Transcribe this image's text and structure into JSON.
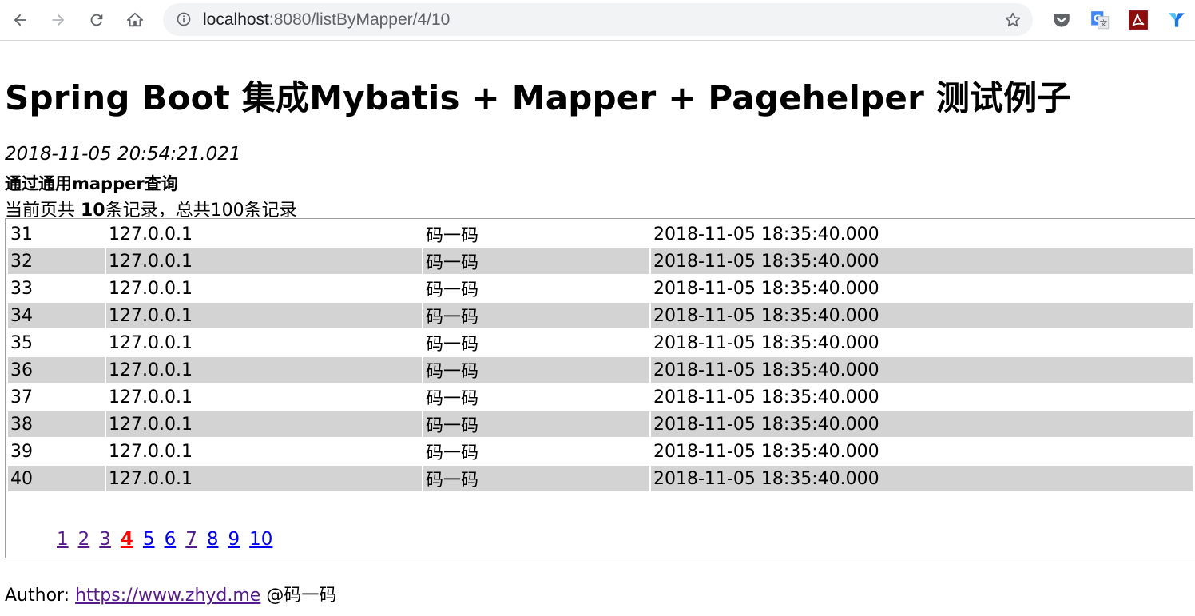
{
  "browser": {
    "url_host": "localhost",
    "url_path": ":8080/listByMapper/4/10",
    "icons": [
      "back-icon",
      "forward-icon",
      "reload-icon",
      "home-icon",
      "info-icon",
      "star-icon",
      "pocket-icon",
      "google-translate-icon",
      "acrobat-icon",
      "extension-icon"
    ]
  },
  "page": {
    "title": "Spring Boot 集成Mybatis + Mapper + Pagehelper 测试例子",
    "timestamp": "2018-11-05 20:54:21.021",
    "query_title": "通过通用mapper查询",
    "summary_prefix": "当前页共 ",
    "summary_count": "10",
    "summary_suffix": "条记录，总共100条记录"
  },
  "table": {
    "rows": [
      {
        "id": "31",
        "ip": "127.0.0.1",
        "user": "码一码",
        "time": "2018-11-05 18:35:40.000"
      },
      {
        "id": "32",
        "ip": "127.0.0.1",
        "user": "码一码",
        "time": "2018-11-05 18:35:40.000"
      },
      {
        "id": "33",
        "ip": "127.0.0.1",
        "user": "码一码",
        "time": "2018-11-05 18:35:40.000"
      },
      {
        "id": "34",
        "ip": "127.0.0.1",
        "user": "码一码",
        "time": "2018-11-05 18:35:40.000"
      },
      {
        "id": "35",
        "ip": "127.0.0.1",
        "user": "码一码",
        "time": "2018-11-05 18:35:40.000"
      },
      {
        "id": "36",
        "ip": "127.0.0.1",
        "user": "码一码",
        "time": "2018-11-05 18:35:40.000"
      },
      {
        "id": "37",
        "ip": "127.0.0.1",
        "user": "码一码",
        "time": "2018-11-05 18:35:40.000"
      },
      {
        "id": "38",
        "ip": "127.0.0.1",
        "user": "码一码",
        "time": "2018-11-05 18:35:40.000"
      },
      {
        "id": "39",
        "ip": "127.0.0.1",
        "user": "码一码",
        "time": "2018-11-05 18:35:40.000"
      },
      {
        "id": "40",
        "ip": "127.0.0.1",
        "user": "码一码",
        "time": "2018-11-05 18:35:40.000"
      }
    ]
  },
  "pagination": {
    "pages": [
      "1",
      "2",
      "3",
      "4",
      "5",
      "6",
      "7",
      "8",
      "9",
      "10"
    ],
    "current": "4",
    "visited": [
      "1",
      "2",
      "3",
      "7"
    ]
  },
  "footer": {
    "author_label": "Author: ",
    "author_link": "https://www.zhyd.me",
    "author_suffix": " @码一码"
  },
  "colors": {
    "row_alt": "#d3d3d3",
    "link": "#0000ee",
    "link_visited": "#551a8b",
    "current_page": "#ff0000"
  }
}
